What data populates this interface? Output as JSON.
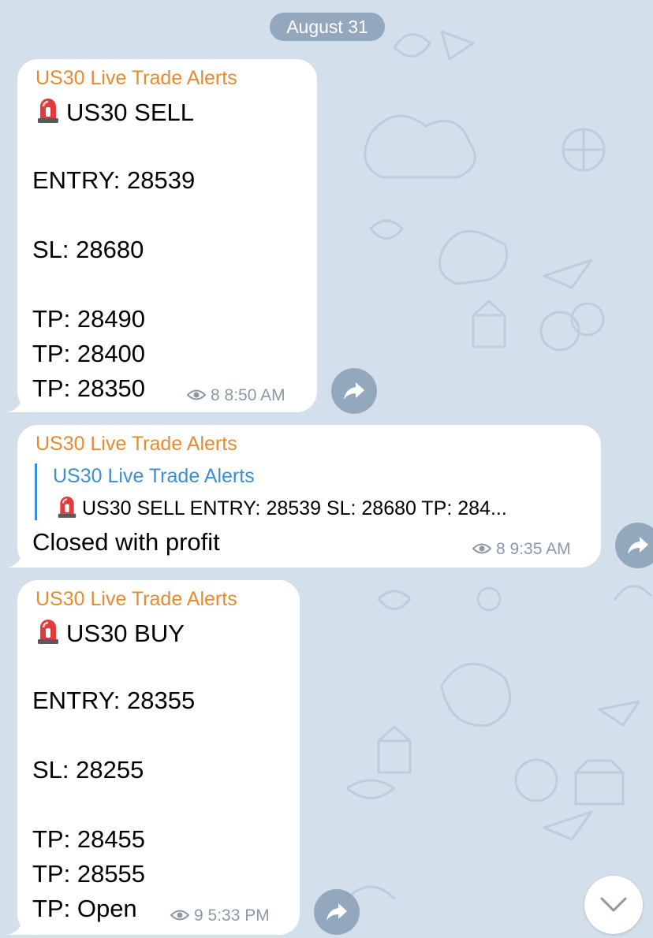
{
  "date_label": "August 31",
  "colors": {
    "background": "#d3dfeb",
    "sender_name": "#e88a2e",
    "reply_accent": "#3a8fd6",
    "meta_text": "#8c99a6"
  },
  "messages": [
    {
      "sender": "US30 Live Trade Alerts",
      "lines": [
        "US30 SELL",
        "ENTRY: 28539",
        "SL:  28680",
        "TP:  28490",
        "TP:  28400",
        "TP:  28350"
      ],
      "leading_icon": "siren-emoji",
      "views": "8",
      "time": "8:50 AM"
    },
    {
      "sender": "US30 Live Trade Alerts",
      "reply": {
        "sender": "US30 Live Trade Alerts",
        "text": "US30 SELL ENTRY: 28539 SL:  28680 TP:  284..."
      },
      "lines": [
        "Closed with profit"
      ],
      "views": "8",
      "time": "9:35 AM"
    },
    {
      "sender": "US30 Live Trade Alerts",
      "lines": [
        "US30 BUY",
        "ENTRY:  28355",
        "SL:  28255",
        "TP:  28455",
        "TP:  28555",
        "TP:  Open"
      ],
      "leading_icon": "siren-emoji",
      "views": "9",
      "time": "5:33 PM"
    }
  ],
  "icons": {
    "views": "eye-icon",
    "share": "share-arrow-icon",
    "scroll": "chevron-down-icon"
  }
}
